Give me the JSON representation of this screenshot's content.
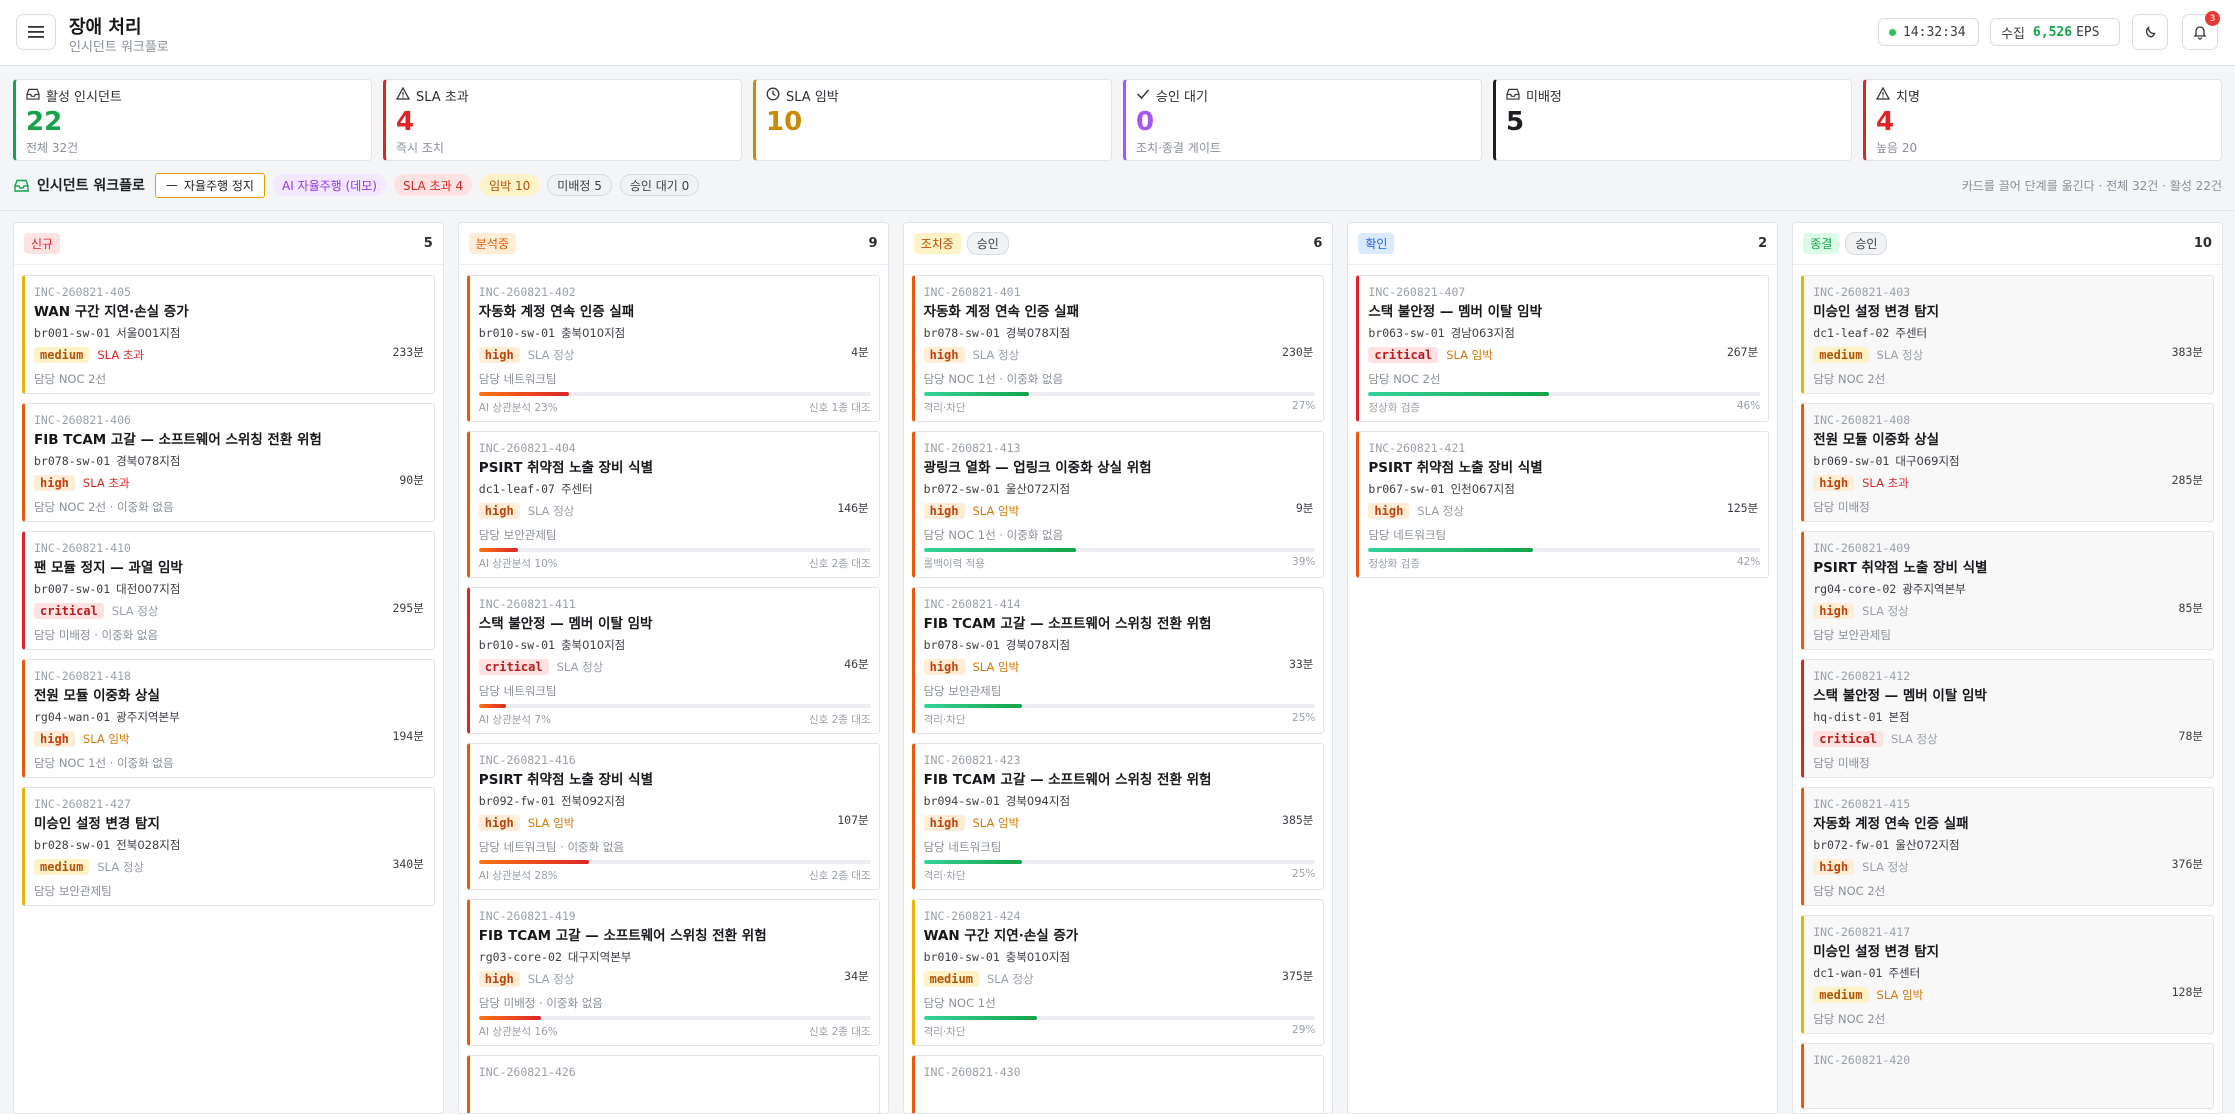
{
  "header": {
    "title": "장애 처리",
    "subtitle": "인시던트 워크플로",
    "clock": "14:32:34",
    "eps_label": "수집",
    "eps_value": "6,526",
    "eps_unit": "EPS",
    "notification_count": "3"
  },
  "summary": [
    {
      "label": "활성 인시던트",
      "value": "22",
      "sub": "전체 32건",
      "color": "#16a34a",
      "icon": "inbox-icon"
    },
    {
      "label": "SLA 초과",
      "value": "4",
      "sub": "즉시 조치",
      "color": "#dc2626",
      "icon": "warning-icon"
    },
    {
      "label": "SLA 임박",
      "value": "10",
      "sub": "",
      "color": "#ca8a04",
      "icon": "clock-icon"
    },
    {
      "label": "승인 대기",
      "value": "0",
      "sub": "조치·종결 게이트",
      "color": "#a855f7",
      "icon": "check-icon"
    },
    {
      "label": "미배정",
      "value": "5",
      "sub": "",
      "color": "#1d1f23",
      "icon": "inbox-icon"
    },
    {
      "label": "치명",
      "value": "4",
      "sub": "높음 20",
      "color": "#dc2626",
      "icon": "warning-icon"
    }
  ],
  "toolbar": {
    "title": "인시던트 워크플로",
    "stop_label": "자율주행 정지",
    "chip_ai": "AI 자율주행 (데모)",
    "chip_sla": "SLA 초과 4",
    "chip_imminent": "임박 10",
    "chip_unassigned": "미배정 5",
    "chip_approval": "승인 대기 0",
    "hint": "카드를 끌어 단계를 옮긴다 · 전체 32건 · 활성 22건"
  },
  "columns": [
    {
      "title": "신규",
      "title_bg": "#fee2e2",
      "title_color": "#dc2626",
      "approve": "",
      "count": "5",
      "cards": [
        {
          "id": "INC-260821-405",
          "title": "WAN 구간 지연·손실 증가",
          "device": "br001-sw-01",
          "site": "서울001지점",
          "sev": "medium",
          "sla": "SLA 초과",
          "sla_type": "over",
          "mins": "233분",
          "owner": "담당 NOC 2선",
          "bar": "#eab308"
        },
        {
          "id": "INC-260821-406",
          "title": "FIB TCAM 고갈 — 소프트웨어 스위칭 전환 위험",
          "device": "br078-sw-01",
          "site": "경북078지점",
          "sev": "high",
          "sla": "SLA 초과",
          "sla_type": "over",
          "mins": "90분",
          "owner": "담당 NOC 2선 · 이중화 없음",
          "bar": "#ea580c"
        },
        {
          "id": "INC-260821-410",
          "title": "팬 모듈 정지 — 과열 임박",
          "device": "br007-sw-01",
          "site": "대전007지점",
          "sev": "critical",
          "sla": "SLA 정상",
          "sla_type": "ok",
          "mins": "295분",
          "owner": "담당 미배정 · 이중화 없음",
          "bar": "#dc2626"
        },
        {
          "id": "INC-260821-418",
          "title": "전원 모듈 이중화 상실",
          "device": "rg04-wan-01",
          "site": "광주지역본부",
          "sev": "high",
          "sla": "SLA 임박",
          "sla_type": "near",
          "mins": "194분",
          "owner": "담당 NOC 1선 · 이중화 없음",
          "bar": "#ea580c"
        },
        {
          "id": "INC-260821-427",
          "title": "미승인 설정 변경 탐지",
          "device": "br028-sw-01",
          "site": "전북028지점",
          "sev": "medium",
          "sla": "SLA 정상",
          "sla_type": "ok",
          "mins": "340분",
          "owner": "담당 보안관제팀",
          "bar": "#eab308"
        }
      ]
    },
    {
      "title": "분석중",
      "title_bg": "#ffedd5",
      "title_color": "#ea580c",
      "approve": "",
      "count": "9",
      "cards": [
        {
          "id": "INC-260821-402",
          "title": "자동화 계정 연속 인증 실패",
          "device": "br010-sw-01",
          "site": "충북010지점",
          "sev": "high",
          "sla": "SLA 정상",
          "sla_type": "ok",
          "mins": "4분",
          "owner": "담당 네트워크팀",
          "bar": "#ea580c",
          "progress": 23,
          "pcolor": "#ea580c",
          "pleft": "AI 상관분석 23%",
          "pright": "신호 1종 대조"
        },
        {
          "id": "INC-260821-404",
          "title": "PSIRT 취약점 노출 장비 식별",
          "device": "dc1-leaf-07",
          "site": "주센터",
          "sev": "high",
          "sla": "SLA 정상",
          "sla_type": "ok",
          "mins": "146분",
          "owner": "담당 보안관제팀",
          "bar": "#ea580c",
          "progress": 10,
          "pcolor": "#ea580c",
          "pleft": "AI 상관분석 10%",
          "pright": "신호 2종 대조"
        },
        {
          "id": "INC-260821-411",
          "title": "스택 불안정 — 멤버 이탈 임박",
          "device": "br010-sw-01",
          "site": "충북010지점",
          "sev": "critical",
          "sla": "SLA 정상",
          "sla_type": "ok",
          "mins": "46분",
          "owner": "담당 네트워크팀",
          "bar": "#dc2626",
          "progress": 7,
          "pcolor": "#ea580c",
          "pleft": "AI 상관분석 7%",
          "pright": "신호 2종 대조"
        },
        {
          "id": "INC-260821-416",
          "title": "PSIRT 취약점 노출 장비 식별",
          "device": "br092-fw-01",
          "site": "전북092지점",
          "sev": "high",
          "sla": "SLA 임박",
          "sla_type": "near",
          "mins": "107분",
          "owner": "담당 네트워크팀 · 이중화 없음",
          "bar": "#ea580c",
          "progress": 28,
          "pcolor": "#ea580c",
          "pleft": "AI 상관분석 28%",
          "pright": "신호 2종 대조"
        },
        {
          "id": "INC-260821-419",
          "title": "FIB TCAM 고갈 — 소프트웨어 스위칭 전환 위험",
          "device": "rg03-core-02",
          "site": "대구지역본부",
          "sev": "high",
          "sla": "SLA 정상",
          "sla_type": "ok",
          "mins": "34분",
          "owner": "담당 미배정 · 이중화 없음",
          "bar": "#ea580c",
          "progress": 16,
          "pcolor": "#ea580c",
          "pleft": "AI 상관분석 16%",
          "pright": "신호 2종 대조"
        },
        {
          "id": "INC-260821-426",
          "title": "",
          "device": "",
          "site": "",
          "sev": "",
          "sla": "",
          "sla_type": "ok",
          "mins": "",
          "owner": "",
          "bar": "#ea580c"
        }
      ]
    },
    {
      "title": "조치중",
      "title_bg": "#fef3c7",
      "title_color": "#b45309",
      "approve": "승인",
      "count": "6",
      "cards": [
        {
          "id": "INC-260821-401",
          "title": "자동화 계정 연속 인증 실패",
          "device": "br078-sw-01",
          "site": "경북078지점",
          "sev": "high",
          "sla": "SLA 정상",
          "sla_type": "ok",
          "mins": "230분",
          "owner": "담당 NOC 1선 · 이중화 없음",
          "bar": "#ea580c",
          "progress": 27,
          "pcolor": "#22c55e",
          "pleft": "격리·차단",
          "pright": "27%"
        },
        {
          "id": "INC-260821-413",
          "title": "광링크 열화 — 업링크 이중화 상실 위험",
          "device": "br072-sw-01",
          "site": "울산072지점",
          "sev": "high",
          "sla": "SLA 임박",
          "sla_type": "near",
          "mins": "9분",
          "owner": "담당 NOC 1선 · 이중화 없음",
          "bar": "#ea580c",
          "progress": 39,
          "pcolor": "#22c55e",
          "pleft": "롤백이력 적용",
          "pright": "39%"
        },
        {
          "id": "INC-260821-414",
          "title": "FIB TCAM 고갈 — 소프트웨어 스위칭 전환 위험",
          "device": "br078-sw-01",
          "site": "경북078지점",
          "sev": "high",
          "sla": "SLA 임박",
          "sla_type": "near",
          "mins": "33분",
          "owner": "담당 보안관제팀",
          "bar": "#ea580c",
          "progress": 25,
          "pcolor": "#22c55e",
          "pleft": "격리·차단",
          "pright": "25%"
        },
        {
          "id": "INC-260821-423",
          "title": "FIB TCAM 고갈 — 소프트웨어 스위칭 전환 위험",
          "device": "br094-sw-01",
          "site": "경북094지점",
          "sev": "high",
          "sla": "SLA 임박",
          "sla_type": "near",
          "mins": "385분",
          "owner": "담당 네트워크팀",
          "bar": "#ea580c",
          "progress": 25,
          "pcolor": "#22c55e",
          "pleft": "격리·차단",
          "pright": "25%"
        },
        {
          "id": "INC-260821-424",
          "title": "WAN 구간 지연·손실 증가",
          "device": "br010-sw-01",
          "site": "충북010지점",
          "sev": "medium",
          "sla": "SLA 정상",
          "sla_type": "ok",
          "mins": "375분",
          "owner": "담당 NOC 1선",
          "bar": "#eab308",
          "progress": 29,
          "pcolor": "#22c55e",
          "pleft": "격리·차단",
          "pright": "29%"
        },
        {
          "id": "INC-260821-430",
          "title": "",
          "device": "",
          "site": "",
          "sev": "",
          "sla": "",
          "sla_type": "ok",
          "mins": "",
          "owner": "",
          "bar": "#ea580c"
        }
      ]
    },
    {
      "title": "확인",
      "title_bg": "#dbeafe",
      "title_color": "#2563eb",
      "approve": "",
      "count": "2",
      "cards": [
        {
          "id": "INC-260821-407",
          "title": "스택 불안정 — 멤버 이탈 임박",
          "device": "br063-sw-01",
          "site": "경남063지점",
          "sev": "critical",
          "sla": "SLA 임박",
          "sla_type": "near",
          "mins": "267분",
          "owner": "담당 NOC 2선",
          "bar": "#dc2626",
          "progress": 46,
          "pcolor": "#22c55e",
          "pleft": "정상화 검증",
          "pright": "46%"
        },
        {
          "id": "INC-260821-421",
          "title": "PSIRT 취약점 노출 장비 식별",
          "device": "br067-sw-01",
          "site": "인천067지점",
          "sev": "high",
          "sla": "SLA 정상",
          "sla_type": "ok",
          "mins": "125분",
          "owner": "담당 네트워크팀",
          "bar": "#ea580c",
          "progress": 42,
          "pcolor": "#22c55e",
          "pleft": "정상화 검증",
          "pright": "42%"
        }
      ]
    },
    {
      "title": "종결",
      "title_bg": "#dcfce7",
      "title_color": "#16a34a",
      "approve": "승인",
      "count": "10",
      "cards": [
        {
          "id": "INC-260821-403",
          "title": "미승인 설정 변경 탐지",
          "device": "dc1-leaf-02",
          "site": "주센터",
          "sev": "medium",
          "sla": "SLA 정상",
          "sla_type": "ok",
          "mins": "383분",
          "owner": "담당 NOC 2선",
          "bar": "#eab308"
        },
        {
          "id": "INC-260821-408",
          "title": "전원 모듈 이중화 상실",
          "device": "br069-sw-01",
          "site": "대구069지점",
          "sev": "high",
          "sla": "SLA 초과",
          "sla_type": "over",
          "mins": "285분",
          "owner": "담당 미배정",
          "bar": "#ea580c"
        },
        {
          "id": "INC-260821-409",
          "title": "PSIRT 취약점 노출 장비 식별",
          "device": "rg04-core-02",
          "site": "광주지역본부",
          "sev": "high",
          "sla": "SLA 정상",
          "sla_type": "ok",
          "mins": "85분",
          "owner": "담당 보안관제팀",
          "bar": "#ea580c"
        },
        {
          "id": "INC-260821-412",
          "title": "스택 불안정 — 멤버 이탈 임박",
          "device": "hq-dist-01",
          "site": "본점",
          "sev": "critical",
          "sla": "SLA 정상",
          "sla_type": "ok",
          "mins": "78분",
          "owner": "담당 미배정",
          "bar": "#dc2626"
        },
        {
          "id": "INC-260821-415",
          "title": "자동화 계정 연속 인증 실패",
          "device": "br072-fw-01",
          "site": "울산072지점",
          "sev": "high",
          "sla": "SLA 정상",
          "sla_type": "ok",
          "mins": "376분",
          "owner": "담당 NOC 2선",
          "bar": "#ea580c"
        },
        {
          "id": "INC-260821-417",
          "title": "미승인 설정 변경 탐지",
          "device": "dc1-wan-01",
          "site": "주센터",
          "sev": "medium",
          "sla": "SLA 임박",
          "sla_type": "near",
          "mins": "128분",
          "owner": "담당 NOC 2선",
          "bar": "#eab308"
        },
        {
          "id": "INC-260821-420",
          "title": "",
          "device": "",
          "site": "",
          "sev": "",
          "sla": "",
          "sla_type": "ok",
          "mins": "",
          "owner": "",
          "bar": "#ea580c"
        }
      ]
    }
  ]
}
